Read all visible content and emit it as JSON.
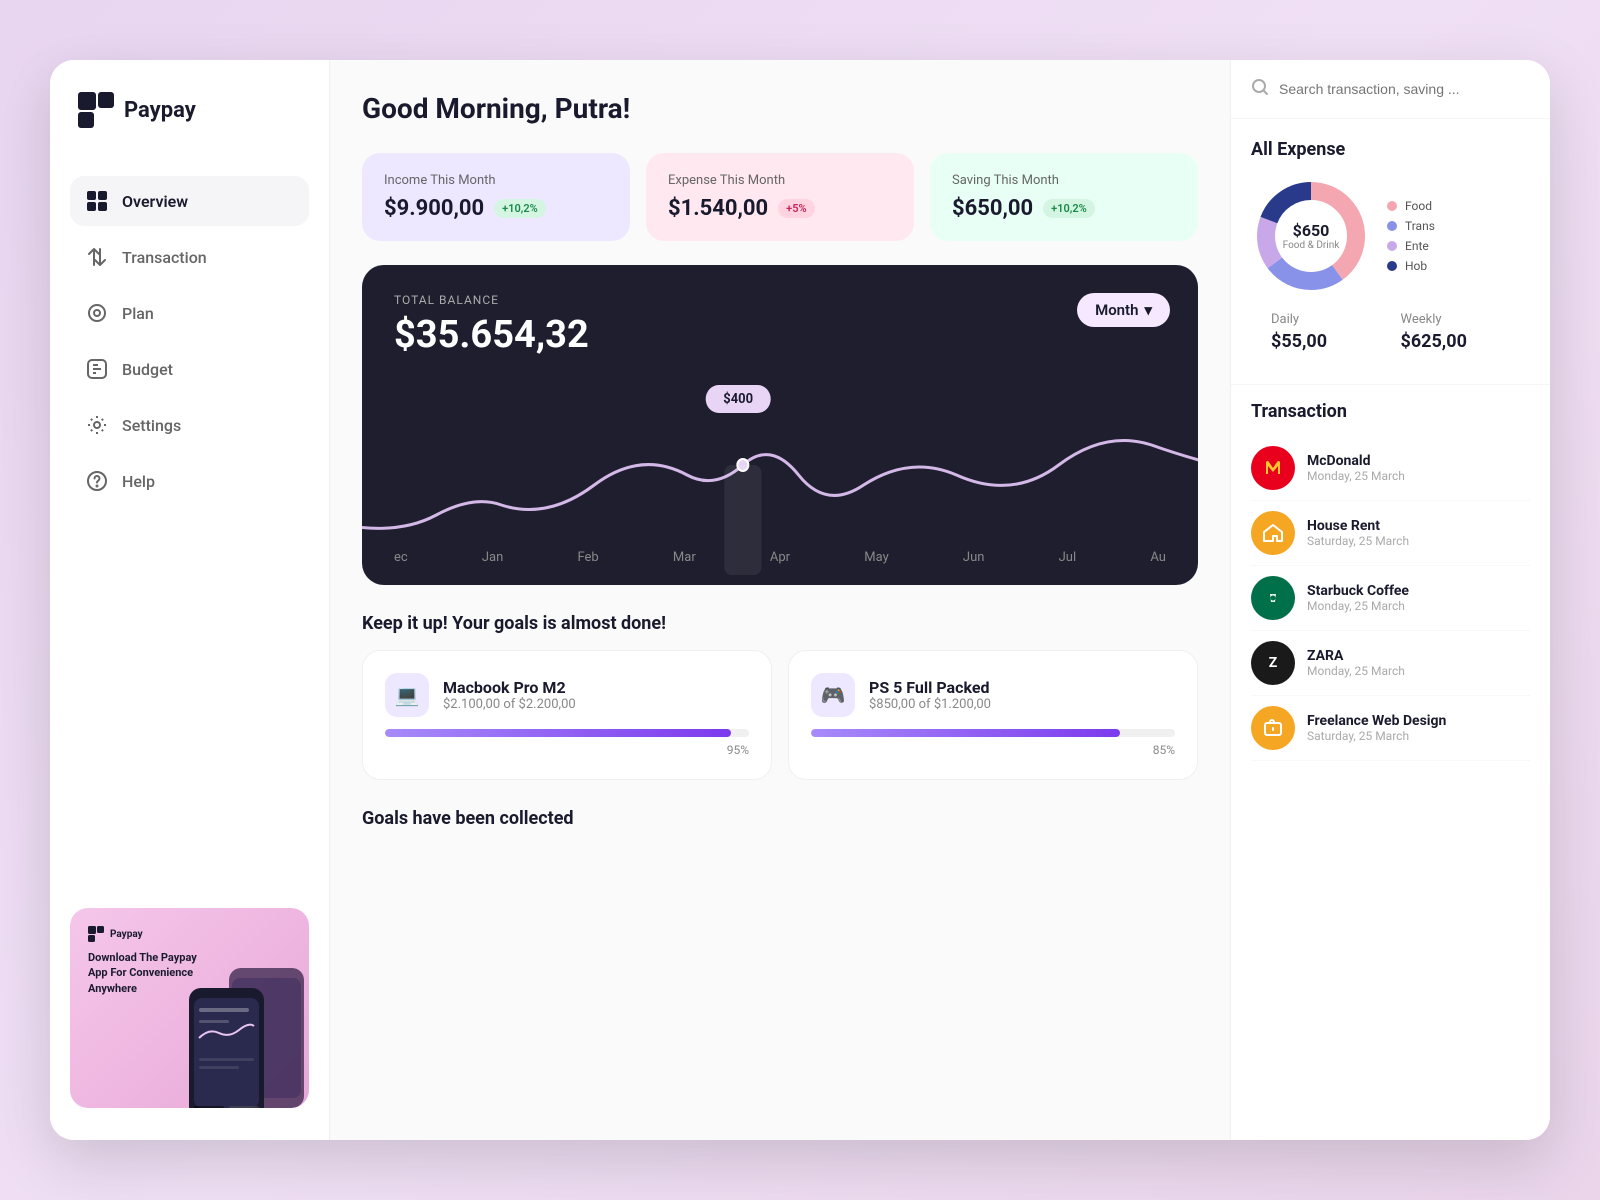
{
  "app": {
    "name": "Paypay"
  },
  "header": {
    "greeting": "Good Morning, Putra!",
    "search_placeholder": "Search transaction, saving ..."
  },
  "sidebar": {
    "nav_items": [
      {
        "id": "overview",
        "label": "Overview",
        "active": true
      },
      {
        "id": "transaction",
        "label": "Transaction",
        "active": false
      },
      {
        "id": "plan",
        "label": "Plan",
        "active": false
      },
      {
        "id": "budget",
        "label": "Budget",
        "active": false
      },
      {
        "id": "settings",
        "label": "Settings",
        "active": false
      },
      {
        "id": "help",
        "label": "Help",
        "active": false
      }
    ],
    "promo": {
      "logo": "Paypay",
      "title": "Download The Paypay App For Convenience Anywhere"
    }
  },
  "stats": [
    {
      "id": "income",
      "label": "Income This Month",
      "value": "$9.900,00",
      "badge": "+10,2%",
      "type": "positive"
    },
    {
      "id": "expense",
      "label": "Expense This Month",
      "value": "$1.540,00",
      "badge": "+5%",
      "type": "negative"
    },
    {
      "id": "saving",
      "label": "Saving This Month",
      "value": "$650,00",
      "badge": "+10,2%",
      "type": "positive"
    }
  ],
  "balance": {
    "label": "TOTAL BALANCE",
    "value": "$35.654,32",
    "period_selector": "Month",
    "tooltip_value": "$400",
    "chart_months": [
      "ec",
      "Jan",
      "Feb",
      "Mar",
      "Apr",
      "May",
      "Jun",
      "Jul",
      "Au"
    ]
  },
  "goals_section": {
    "title": "Keep it up! Your goals is almost done!",
    "items": [
      {
        "id": "macbook",
        "name": "Macbook Pro M2",
        "icon": "💻",
        "amount": "$2.100,00",
        "total": "$2.200,00",
        "progress": 95,
        "progress_label": "95%"
      },
      {
        "id": "ps5",
        "name": "PS 5 Full Packed",
        "icon": "🎮",
        "amount": "$850,00",
        "total": "$1.200,00",
        "progress": 85,
        "progress_label": "85%"
      }
    ]
  },
  "goals_collected": {
    "title": "Goals have been collected"
  },
  "right_panel": {
    "expense": {
      "title": "All Expense",
      "donut_amount": "$650",
      "donut_label": "Food & Drink",
      "legend": [
        {
          "id": "food",
          "label": "Food",
          "color": "#f4a7b0"
        },
        {
          "id": "transport",
          "label": "Trans",
          "color": "#b0b8f4"
        },
        {
          "id": "entertainment",
          "label": "Ente",
          "color": "#e8c5f0"
        },
        {
          "id": "hobbies",
          "label": "Hob",
          "color": "#d0e8f0"
        }
      ]
    },
    "daily": {
      "label": "Daily",
      "value": "$55,00"
    },
    "weekly": {
      "label": "Weekly",
      "value": "$625,00"
    },
    "transactions": {
      "title": "Transaction",
      "items": [
        {
          "id": "mcdonalds",
          "name": "McDonald",
          "date": "Monday, 25 March",
          "icon_type": "mcdonalds",
          "icon_text": "🍔"
        },
        {
          "id": "house-rent",
          "name": "House Rent",
          "date": "Saturday, 25 March",
          "icon_type": "house",
          "icon_text": "🏠"
        },
        {
          "id": "starbucks",
          "name": "Starbuck Coffee",
          "date": "Monday, 25 March",
          "icon_type": "starbucks",
          "icon_text": "☕"
        },
        {
          "id": "zara",
          "name": "ZARA",
          "date": "Monday, 25 March",
          "icon_type": "zara",
          "icon_text": "Z"
        },
        {
          "id": "freelance",
          "name": "Freelance Web Design",
          "date": "Saturday, 25 March",
          "icon_type": "freelance",
          "icon_text": "💼"
        }
      ]
    }
  }
}
